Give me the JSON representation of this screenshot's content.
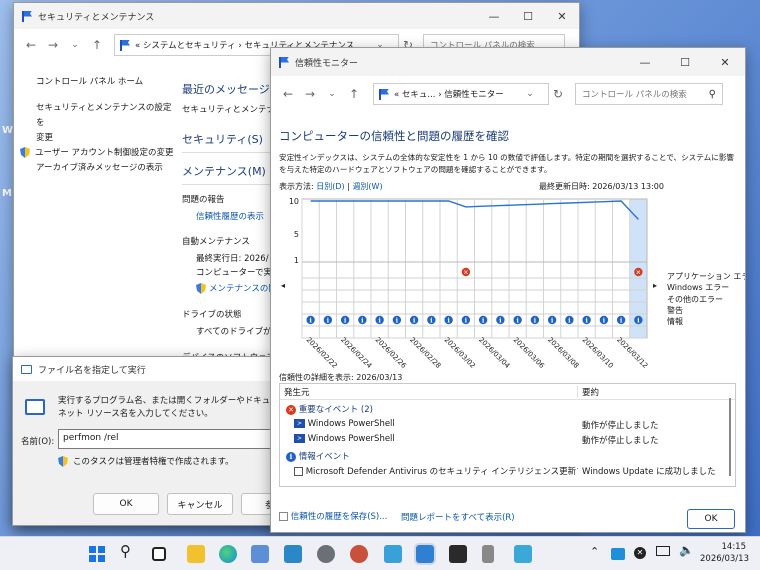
{
  "desktop": {
    "icon1": "W",
    "icon2": "M"
  },
  "security_window": {
    "title": "セキュリティとメンテナンス",
    "address": "«  システムとセキュリティ  ›  セキュリティとメンテナンス",
    "search_placeholder": "コントロール パネルの検索",
    "left_links": [
      "コントロール パネル ホーム",
      "セキュリティとメンテナンスの設定を",
      "変更",
      "ユーザー アカウント制御設定の変更",
      "アーカイブ済みメッセージの表示"
    ],
    "heading": "最近のメッセージを",
    "heading_sub": "セキュリティとメンテナンスで",
    "section_security": "セキュリティ(S)",
    "section_maintenance": "メンテナンス(M)",
    "problem_report": "問題の報告",
    "view_reliability": "信頼性履歴の表示",
    "auto_maintenance": "自動メンテナンス",
    "last_run": "最終実行日: 2026/",
    "computer_run": "コンピューターで実行",
    "maintenance_link": "メンテナンスの開",
    "drive_status": "ドライブの状態",
    "all_drives": "すべてのドライブが",
    "device_software": "デバイスのソフトウェア"
  },
  "run_dialog": {
    "title": "ファイル名を指定して実行",
    "desc1": "実行するプログラム名、または開くフォルダーやドキュメント名、インター",
    "desc2": "ネット リソース名を入力してください。",
    "name_label": "名前(O):",
    "name_value": "perfmon /rel",
    "admin_note": "このタスクは管理者特権で作成されます。",
    "ok": "OK",
    "cancel": "キャンセル",
    "browse": "参照"
  },
  "reliability_window": {
    "title": "信頼性モニター",
    "address": "«  セキュ...  ›  信頼性モニター",
    "search_placeholder": "コントロール パネルの検索",
    "heading": "コンピューターの信頼性と問題の履歴を確認",
    "desc1": "安定性インデックスは、システムの全体的な安定性を 1 から 10 の数値で評価します。特定の期間を選択することで、システムに影響",
    "desc2": "を与えた特定のハードウェアとソフトウェアの問題を確認することができます。",
    "view_by": "表示方法:",
    "view_days": "日別(D)",
    "view_sep": " | ",
    "view_weeks": "週別(W)",
    "last_updated": "最終更新日時: 2026/03/13 13:00",
    "y_labels": [
      "10",
      "5",
      "1"
    ],
    "row_labels": [
      "アプリケーション エラー",
      "Windows エラー",
      "その他のエラー",
      "警告",
      "情報"
    ],
    "dates": [
      "2026/02/22",
      "2026/02/24",
      "2026/02/26",
      "2026/02/28",
      "2026/03/02",
      "2026/03/04",
      "2026/03/06",
      "2026/03/08",
      "2026/03/10",
      "2026/03/12"
    ],
    "details_for": "信頼性の詳細を表示: 2026/03/13",
    "col_source": "発生元",
    "col_summary": "要約",
    "critical_group": "重要なイベント (2)",
    "info_group": "情報イベント",
    "events": [
      {
        "source": "Windows PowerShell",
        "summary": "動作が停止しました"
      },
      {
        "source": "Windows PowerShell",
        "summary": "動作が停止しました"
      }
    ],
    "info_event": {
      "source": "Microsoft Defender Antivirus のセキュリティ インテリジェンス更新プログラ...",
      "summary": "Windows Update に成功しました"
    },
    "save_link": "信頼性の履歴を保存(S)...",
    "report_link": "問題レポートをすべて表示(R)",
    "ok": "OK"
  },
  "chart_data": {
    "type": "line",
    "title": "",
    "x": [
      "2026/02/22",
      "2026/02/23",
      "2026/02/24",
      "2026/02/25",
      "2026/02/26",
      "2026/02/27",
      "2026/02/28",
      "2026/03/01",
      "2026/03/02",
      "2026/03/03",
      "2026/03/04",
      "2026/03/05",
      "2026/03/06",
      "2026/03/07",
      "2026/03/08",
      "2026/03/09",
      "2026/03/10",
      "2026/03/11",
      "2026/03/12",
      "2026/03/13"
    ],
    "series": [
      {
        "values": [
          10,
          10,
          10,
          10,
          10,
          10,
          10,
          10,
          10,
          9.1,
          9.2,
          9.3,
          9.4,
          9.5,
          9.6,
          9.7,
          9.8,
          9.9,
          10,
          7.2
        ]
      }
    ],
    "ylim": [
      1,
      10
    ],
    "application_errors": [
      "2026/03/03",
      "2026/03/13"
    ],
    "info_events_per_day": [
      1,
      1,
      1,
      1,
      1,
      1,
      1,
      1,
      1,
      1,
      1,
      1,
      1,
      1,
      1,
      1,
      1,
      1,
      1,
      1
    ],
    "selected": "2026/03/13"
  },
  "taskbar": {
    "time": "14:15",
    "date": "2026/03/13"
  }
}
